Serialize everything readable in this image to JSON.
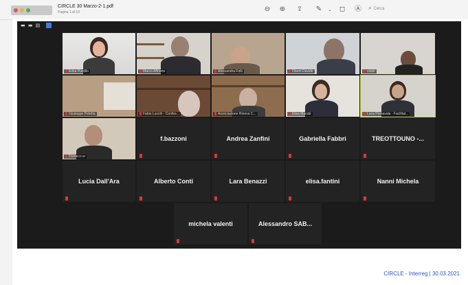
{
  "viewer": {
    "file_name": "CIRCLE 30 Marzo-2-1.pdf",
    "page_info": "Pagina 1 di 10",
    "search_placeholder": "Cerca"
  },
  "participants_video": [
    {
      "label": "Erika Pustillo"
    },
    {
      "label": "Marco Affronte"
    },
    {
      "label": "Alessandra Folli"
    },
    {
      "label": "Oberti Davide"
    },
    {
      "label": "vitalir"
    },
    {
      "label": "Giuseppe Petetta"
    },
    {
      "label": "Fabio Lucchi - Confes..."
    },
    {
      "label": "Associazione Rinova C..."
    },
    {
      "label": "Elisa Marabi"
    },
    {
      "label": "Luca Pomavala - Facilitat..."
    },
    {
      "label": "Domeco sr"
    }
  ],
  "participants_names": [
    "f.bazzoni",
    "Andrea Zanfini",
    "Gabriella Fabbri",
    "TREOTTOUNO -...",
    "Lucia Dall'Ara",
    "Alberto Conti",
    "Lara Benazzi",
    "elisa.fantini",
    "Nanni Michela",
    "michela valenti",
    "Alessandro SAB..."
  ],
  "footer": "CIRCLE - Interreg  |  30.03.2021",
  "colors": {
    "active_border": "#b9d23a",
    "footer_text": "#2a56c6",
    "muted_mic": "#d63a3a"
  }
}
